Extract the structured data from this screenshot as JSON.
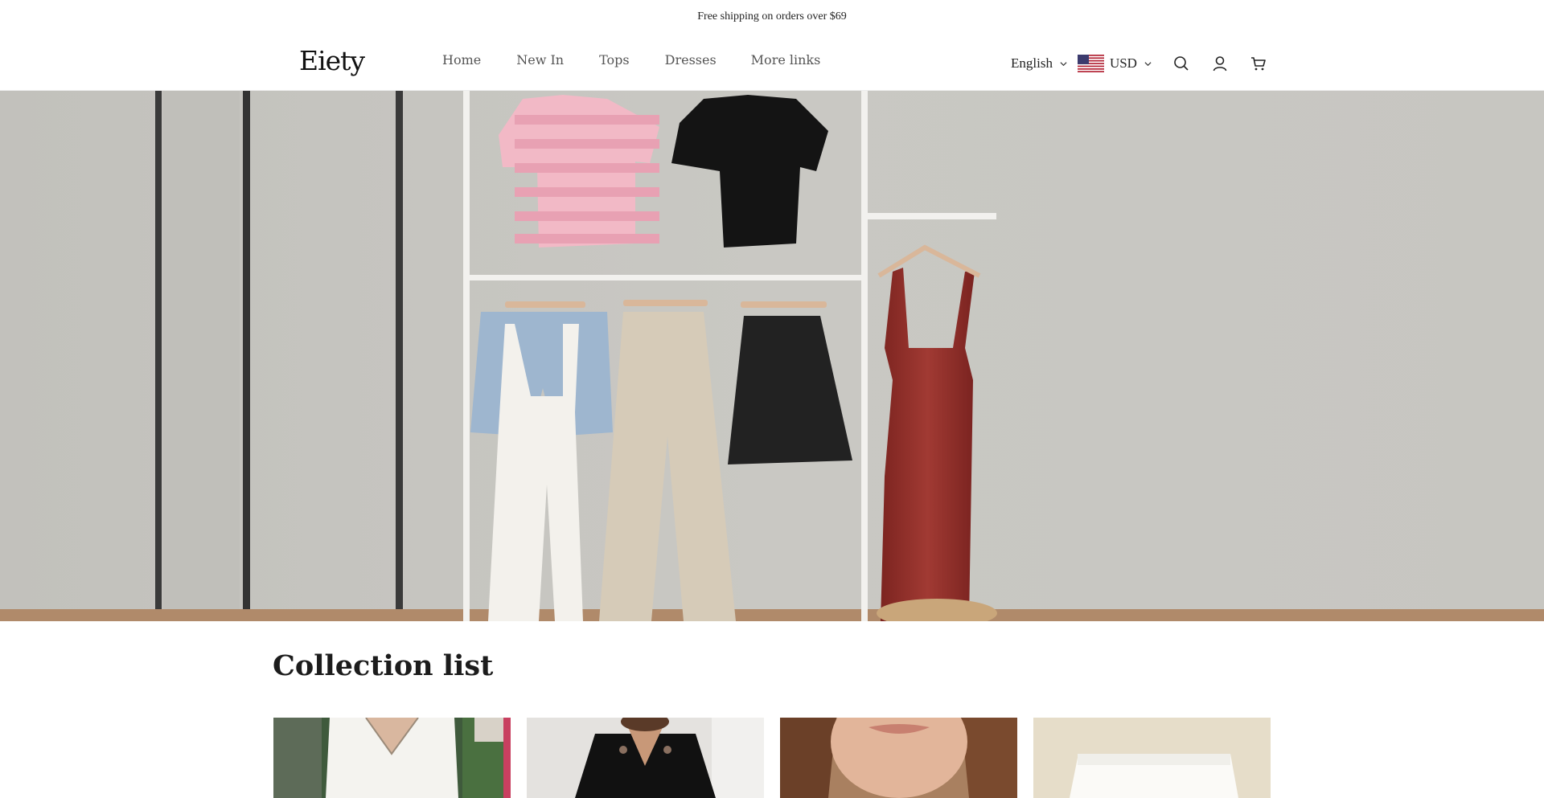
{
  "announcement": {
    "text": "Free shipping on orders over $69"
  },
  "header": {
    "logo": "Eiety",
    "nav": [
      {
        "label": "Home",
        "glyph": ""
      },
      {
        "label": "New In",
        "glyph": ""
      },
      {
        "label": "Tops",
        "glyph": ""
      },
      {
        "label": "Dresses",
        "glyph": ""
      },
      {
        "label": "More links",
        "glyph": ""
      }
    ],
    "language": "English",
    "currency": "USD",
    "icons": [
      "chevron-down-icon",
      "us-flag-icon",
      "search-icon",
      "account-icon",
      "cart-icon"
    ]
  },
  "hero": {
    "image": "clothing-rack-hero-image"
  },
  "collection": {
    "title": "Collection list",
    "cards": [
      {
        "image": "white-sleeveless-top-photo"
      },
      {
        "image": "black-velvet-top-photo"
      },
      {
        "image": "woman-portrait-photo"
      },
      {
        "image": "white-shorts-photo"
      }
    ]
  },
  "colors": {
    "text": "#222222",
    "nav": "#555555",
    "hero_wall": "#c6c5c0",
    "dress": "#8e2c27"
  }
}
